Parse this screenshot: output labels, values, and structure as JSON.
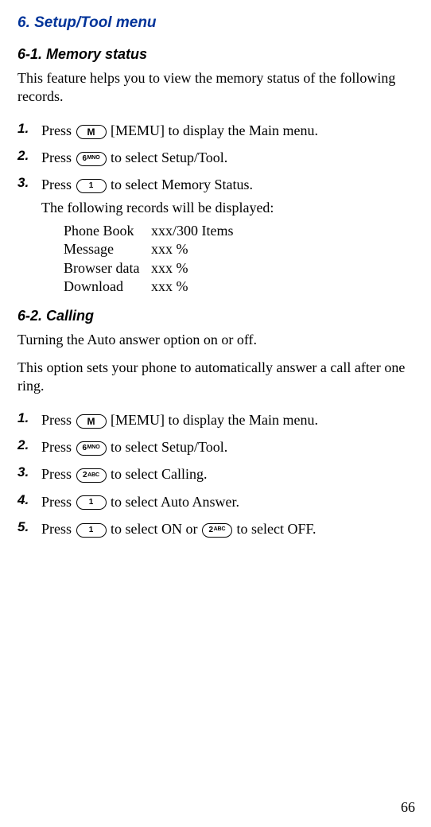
{
  "h1": "6. Setup/Tool menu",
  "section1": {
    "title": "6-1. Memory status",
    "intro": "This feature helps you to view the memory status of the following records.",
    "steps": [
      {
        "num": "1.",
        "before": "Press ",
        "key": "M",
        "after": " [MEMU] to display the Main menu."
      },
      {
        "num": "2.",
        "before": "Press ",
        "key": "6MNO",
        "after": " to select Setup/Tool."
      },
      {
        "num": "3.",
        "before": "Press ",
        "key": "1",
        "after": " to select Memory Status.",
        "line2": "The following records will be displayed:"
      }
    ],
    "records": [
      {
        "name": "Phone Book",
        "value": "xxx/300 Items"
      },
      {
        "name": "Message",
        "value": "xxx %"
      },
      {
        "name": "Browser data",
        "value": "xxx %"
      },
      {
        "name": "Download",
        "value": "xxx %"
      }
    ]
  },
  "section2": {
    "title": "6-2. Calling",
    "intro1": "Turning the Auto answer option on or off.",
    "intro2": "This option sets your phone to automatically answer a call after one ring.",
    "steps": [
      {
        "num": "1.",
        "before": "Press ",
        "key": "M",
        "after": " [MEMU] to display the Main menu."
      },
      {
        "num": "2.",
        "before": "Press ",
        "key": "6MNO",
        "after": " to select Setup/Tool."
      },
      {
        "num": "3.",
        "before": "Press ",
        "key": "2ABC",
        "after": " to select Calling."
      },
      {
        "num": "4.",
        "before": "Press ",
        "key": "1",
        "after": " to select Auto Answer."
      },
      {
        "num": "5.",
        "before": "Press ",
        "key": "1",
        "mid": " to select ON or ",
        "key2": "2ABC",
        "after": " to select OFF."
      }
    ]
  },
  "pageNumber": "66"
}
